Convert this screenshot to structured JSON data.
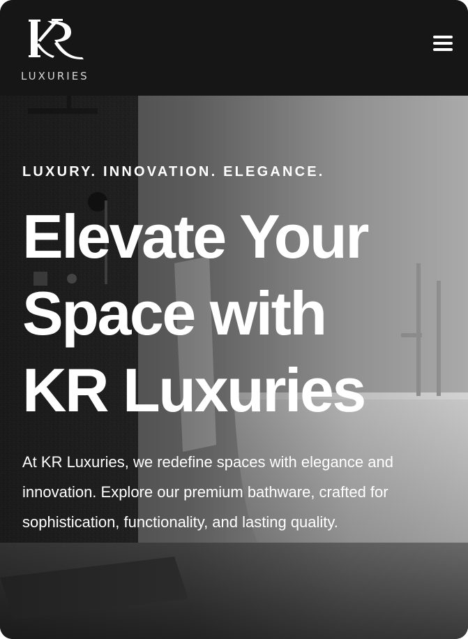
{
  "header": {
    "logo_mark": "KR",
    "logo_word": "LUXURIES",
    "menu_icon": "hamburger-menu-icon"
  },
  "hero": {
    "tagline": "LUXURY. INNOVATION. ELEGANCE.",
    "headline": "Elevate Your\nSpace with\nKR Luxuries",
    "description": "At KR Luxuries, we redefine spaces with elegance and innovation. Explore our premium bathware, crafted for sophistication, functionality, and lasting quality."
  },
  "colors": {
    "header_bg": "#161616",
    "text": "#ffffff",
    "logo_word": "#d8d8d8"
  }
}
